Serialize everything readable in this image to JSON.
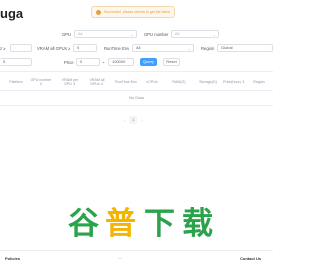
{
  "header": {
    "title": "uga"
  },
  "toast": {
    "message": "Successful, please refresh to get the latest"
  },
  "filters": {
    "row1": {
      "gpu_label": "GPU",
      "gpu_placeholder": "All",
      "gpu_number_label": "GPU number",
      "gpu_number_placeholder": "All"
    },
    "row2": {
      "left_label": "z ≥",
      "vram_label": "VRAM all GPUs ≥",
      "vram_value": "0",
      "runtime_label": "RunTime Env",
      "runtime_value": "All",
      "region_label": "Region",
      "region_value": "Global"
    },
    "row3": {
      "left_value": "5",
      "price_label": "Price",
      "price_min": "0",
      "price_sep": "~",
      "price_max": "100000",
      "query_label": "Query",
      "reset_label": "Reset"
    }
  },
  "table": {
    "headers": [
      "Platform",
      "GPU number ⇕",
      "VRAM per GPU ⇕",
      "VRAM all GPUs ⇕",
      "RunTime Env",
      "vCPUs",
      "RAM(G)",
      "Storage(G)",
      "Price(hour) ⇕",
      "Region"
    ],
    "empty_text": "No Data"
  },
  "pagination": {
    "prev": "‹",
    "page": "1",
    "next": "›"
  },
  "footer": {
    "left": "Policies",
    "middle": "—",
    "right": "Contact Us"
  },
  "watermark": {
    "text": "谷普下载"
  },
  "colors": {
    "primary": "#409eff",
    "warning": "#e6a23c",
    "watermark_green": "#2aa34a",
    "watermark_yellow": "#f4b400"
  }
}
